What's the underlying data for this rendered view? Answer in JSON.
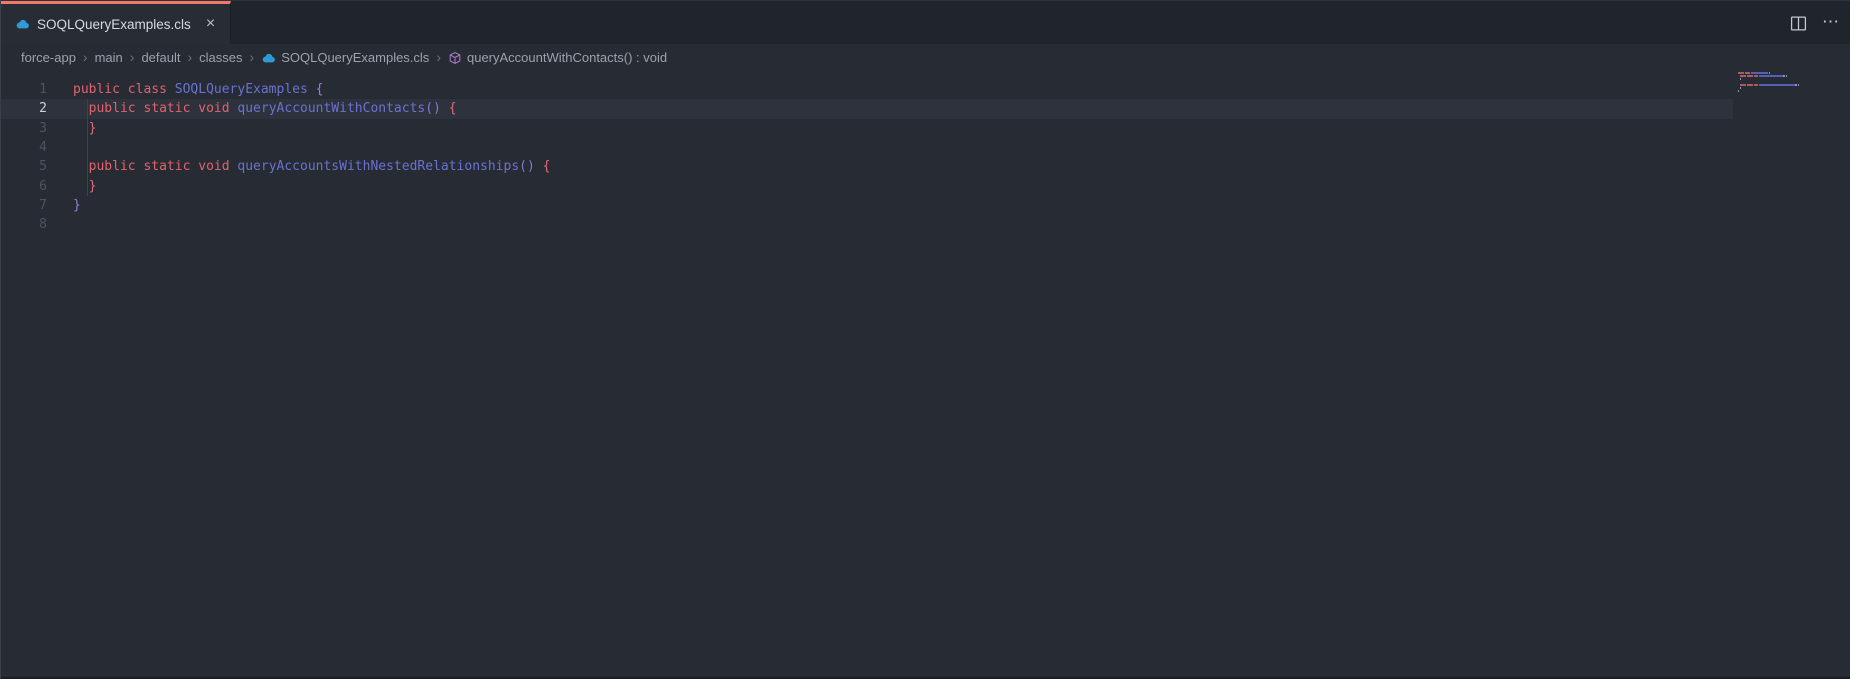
{
  "colors": {
    "editor_bg": "#272b33",
    "tabbar_bg": "#20242b",
    "tab_active_bg": "#282d35",
    "tab_accent": "#f07a65",
    "text_primary": "#d5d9e0",
    "breadcrumb_text": "#9ba2ae",
    "line_number": "#4c5464",
    "line_number_active": "#cbd1db",
    "line_highlight": "#2d323c",
    "indent_guide": "#3d434e",
    "keyword": "#e0636e",
    "identifier": "#6a72cf",
    "brace_outer": "#9c7ed9",
    "brace_inner": "#da6d7c",
    "paren": "#8278d2",
    "apex_icon_blue": "#2f9bd6",
    "method_icon_purple": "#b180d7",
    "minimap_keyword": "#a65d63",
    "minimap_identifier": "#555fb5",
    "minimap_misc": "#8d93a5"
  },
  "tab_bar": {
    "tabs": [
      {
        "label": "SOQLQueryExamples.cls",
        "close_glyph": "×",
        "active": true,
        "icon": "apex-cloud-icon"
      }
    ],
    "actions": [
      {
        "name": "split-editor",
        "glyph": ""
      },
      {
        "name": "more-actions",
        "glyph": "⋯"
      }
    ]
  },
  "breadcrumb": {
    "separator": "›",
    "items": [
      {
        "label": "force-app"
      },
      {
        "label": "main"
      },
      {
        "label": "default"
      },
      {
        "label": "classes"
      },
      {
        "label": "SOQLQueryExamples.cls",
        "icon": "apex-cloud-icon"
      },
      {
        "label": "queryAccountWithContacts() : void",
        "icon": "symbol-method-icon"
      }
    ]
  },
  "editor": {
    "language": "apex",
    "active_line": 2,
    "lines": [
      {
        "num": 1,
        "tokens": [
          [
            "kw",
            "public"
          ],
          [
            "pl",
            " "
          ],
          [
            "kw",
            "class"
          ],
          [
            "pl",
            " "
          ],
          [
            "id",
            "SOQLQueryExamples"
          ],
          [
            "pl",
            " "
          ],
          [
            "bo",
            "{"
          ]
        ]
      },
      {
        "num": 2,
        "tokens": [
          [
            "pl",
            "  "
          ],
          [
            "kw",
            "public"
          ],
          [
            "pl",
            " "
          ],
          [
            "kw",
            "static"
          ],
          [
            "pl",
            " "
          ],
          [
            "kw",
            "void"
          ],
          [
            "pl",
            " "
          ],
          [
            "id",
            "queryAccountWithContacts"
          ],
          [
            "pr",
            "()"
          ],
          [
            "pl",
            " "
          ],
          [
            "bi",
            "{"
          ]
        ]
      },
      {
        "num": 3,
        "tokens": [
          [
            "pl",
            "  "
          ],
          [
            "bi",
            "}"
          ]
        ]
      },
      {
        "num": 4,
        "tokens": []
      },
      {
        "num": 5,
        "tokens": [
          [
            "pl",
            "  "
          ],
          [
            "kw",
            "public"
          ],
          [
            "pl",
            " "
          ],
          [
            "kw",
            "static"
          ],
          [
            "pl",
            " "
          ],
          [
            "kw",
            "void"
          ],
          [
            "pl",
            " "
          ],
          [
            "id",
            "queryAccountsWithNestedRelationships"
          ],
          [
            "pr",
            "()"
          ],
          [
            "pl",
            " "
          ],
          [
            "bi",
            "{"
          ]
        ]
      },
      {
        "num": 6,
        "tokens": [
          [
            "pl",
            "  "
          ],
          [
            "bi",
            "}"
          ]
        ]
      },
      {
        "num": 7,
        "tokens": [
          [
            "bo",
            "}"
          ]
        ]
      },
      {
        "num": 8,
        "tokens": []
      }
    ]
  }
}
